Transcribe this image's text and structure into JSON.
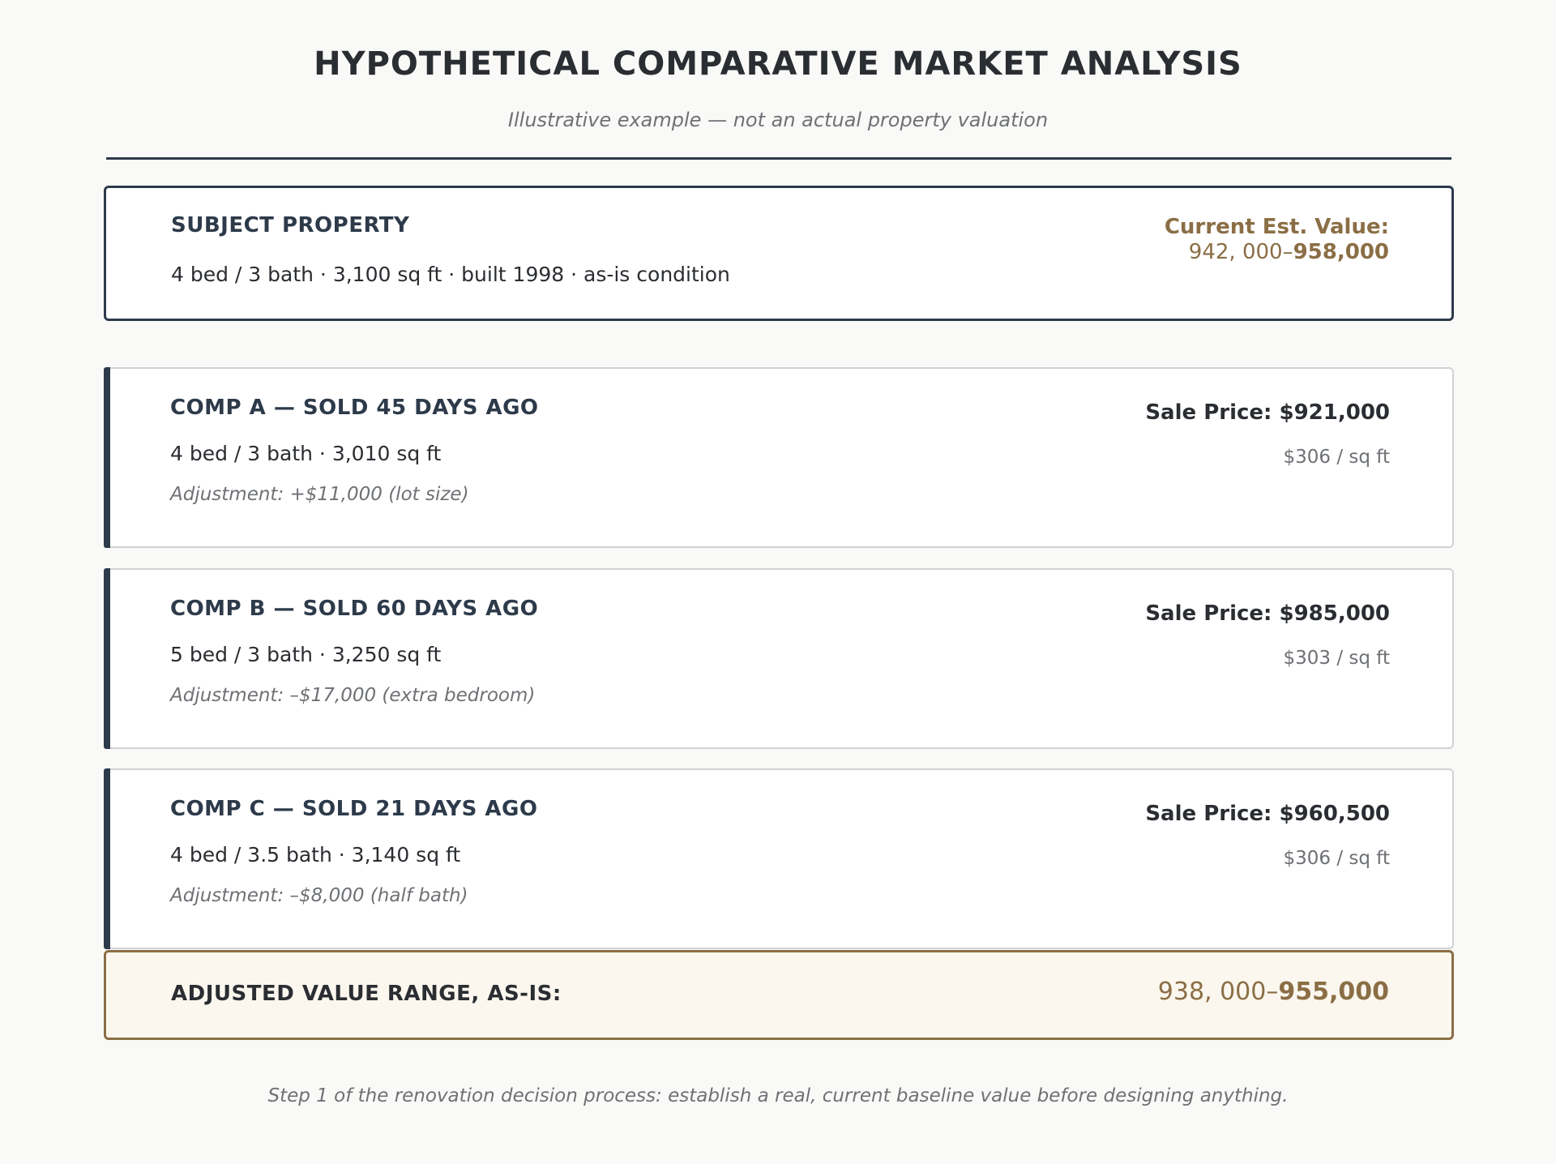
{
  "header": {
    "title": "HYPOTHETICAL COMPARATIVE MARKET ANALYSIS",
    "subtitle": "Illustrative example — not an actual property valuation"
  },
  "subject": {
    "heading": "SUBJECT PROPERTY",
    "details": "4 bed / 3 bath · 3,100 sq ft · built 1998 · as-is condition",
    "value_label": "Current Est. Value:",
    "value_low": "942, 000–",
    "value_high": "958,000"
  },
  "comps": [
    {
      "heading": "COMP A — SOLD 45 DAYS AGO",
      "details": "4 bed / 3 bath  ·  3,010 sq ft",
      "adjustment": "Adjustment: +$11,000 (lot size)",
      "sale_price": "Sale Price: $921,000",
      "per_sqft": "$306 / sq ft"
    },
    {
      "heading": "COMP B — SOLD 60 DAYS AGO",
      "details": "5 bed / 3 bath  ·  3,250 sq ft",
      "adjustment": "Adjustment: –$17,000 (extra bedroom)",
      "sale_price": "Sale Price: $985,000",
      "per_sqft": "$303 / sq ft"
    },
    {
      "heading": "COMP C — SOLD 21 DAYS AGO",
      "details": "4 bed / 3.5 bath  ·  3,140 sq ft",
      "adjustment": "Adjustment: –$8,000 (half bath)",
      "sale_price": "Sale Price: $960,500",
      "per_sqft": "$306 / sq ft"
    }
  ],
  "summary": {
    "heading": "ADJUSTED VALUE RANGE, AS-IS:",
    "range_low": "938, 000–",
    "range_high": "955,000"
  },
  "footer": "Step 1 of the renovation decision process: establish a real, current baseline value before designing anything.",
  "colors": {
    "accent_navy": "#2d3a4a",
    "accent_gold": "#8b6e45",
    "muted_text": "#6e7175"
  }
}
